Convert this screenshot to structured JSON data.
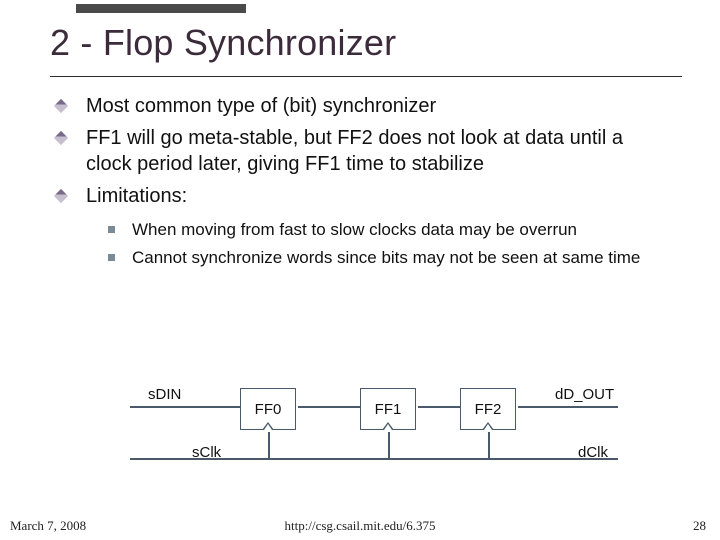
{
  "title": "2 - Flop Synchronizer",
  "bullets": {
    "b0": "Most common type of (bit) synchronizer",
    "b1": "FF1 will go meta-stable, but FF2 does not look at data until a clock period later, giving FF1 time to stabilize",
    "b2": "Limitations:"
  },
  "sub": {
    "s0": "When moving from fast to slow clocks data may be overrun",
    "s1": "Cannot synchronize words since bits may not be seen at same time"
  },
  "diagram": {
    "sdin": "sDIN",
    "ff0": "FF0",
    "ff1": "FF1",
    "ff2": "FF2",
    "dout": "dD_OUT",
    "sclk": "sClk",
    "dclk": "dClk"
  },
  "footer": {
    "date": "March 7, 2008",
    "url": "http://csg.csail.mit.edu/6.375",
    "page": "28"
  }
}
